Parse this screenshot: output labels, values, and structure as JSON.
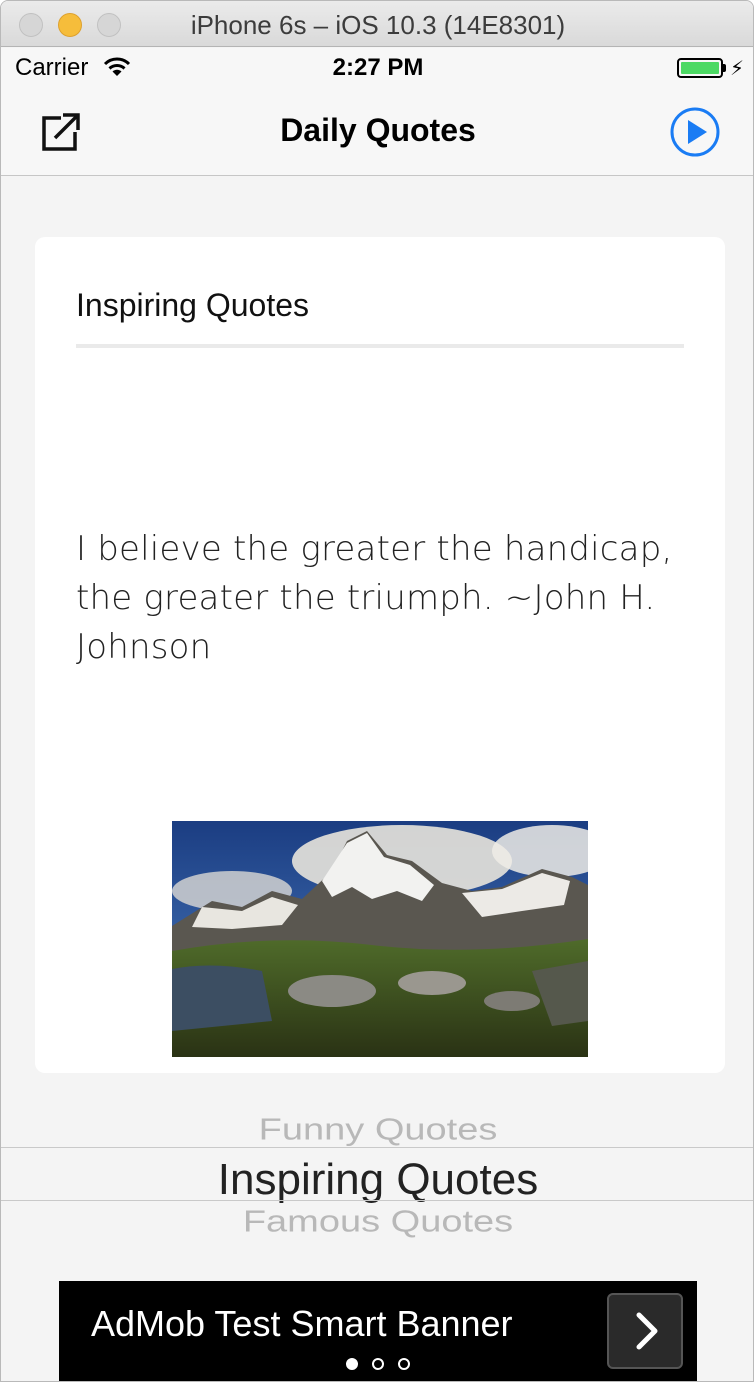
{
  "window": {
    "title": "iPhone 6s – iOS 10.3 (14E8301)"
  },
  "status_bar": {
    "carrier": "Carrier",
    "time": "2:27 PM",
    "battery_level": 1.0,
    "charging": true
  },
  "nav_bar": {
    "title": "Daily Quotes",
    "left_icon": "share-icon",
    "right_icon": "play-icon",
    "accent_color": "#1a7cf4"
  },
  "card": {
    "title": "Inspiring Quotes",
    "quote": "I believe the greater the handicap, the greater the triumph. ~John H. Johnson",
    "image": "mountain-landscape"
  },
  "picker": {
    "previous": "Funny Quotes",
    "selected": "Inspiring Quotes",
    "next": "Famous Quotes"
  },
  "ad_banner": {
    "text": "AdMob Test Smart Banner",
    "button_icon": "chevron-right-icon",
    "page_count": 3,
    "active_page": 1
  }
}
